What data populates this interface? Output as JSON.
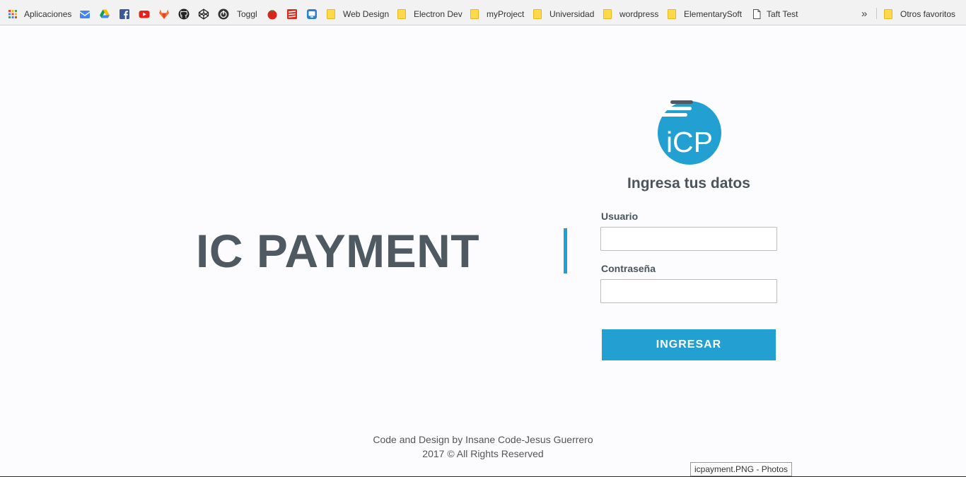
{
  "bookmarks_bar": {
    "apps_label": "Aplicaciones",
    "items": [
      {
        "icon": "inbox-icon"
      },
      {
        "icon": "google-drive-icon"
      },
      {
        "icon": "facebook-icon"
      },
      {
        "icon": "youtube-icon"
      },
      {
        "icon": "gitlab-icon"
      },
      {
        "icon": "github-icon"
      },
      {
        "icon": "codepen-icon"
      },
      {
        "icon": "toggl-icon",
        "label": "Toggl"
      },
      {
        "icon": "tomato-icon"
      },
      {
        "icon": "todoist-icon"
      },
      {
        "icon": "screen-icon"
      },
      {
        "icon": "folder-icon",
        "label": "Web Design"
      },
      {
        "icon": "folder-icon",
        "label": "Electron Dev"
      },
      {
        "icon": "folder-icon",
        "label": "myProject"
      },
      {
        "icon": "folder-icon",
        "label": "Universidad"
      },
      {
        "icon": "folder-icon",
        "label": "wordpress"
      },
      {
        "icon": "folder-icon",
        "label": "ElementarySoft"
      },
      {
        "icon": "page-icon",
        "label": "Taft Test"
      }
    ],
    "overflow_label": "»",
    "other_label": "Otros favoritos"
  },
  "page": {
    "brand": "IC PAYMENT",
    "logo_text": "iCP",
    "form": {
      "title": "Ingresa tus datos",
      "user_label": "Usuario",
      "user_value": "",
      "password_label": "Contraseña",
      "password_value": "",
      "submit_label": "INGRESAR"
    },
    "footer": {
      "line1": "Code and Design by Insane Code-Jesus Guerrero",
      "line2": "2017 © All Rights Reserved"
    }
  },
  "taskbar_tooltip": "icpayment.PNG - Photos",
  "colors": {
    "accent": "#22a0d2",
    "brand_text": "#4e5962",
    "background": "#fcfcfe"
  }
}
